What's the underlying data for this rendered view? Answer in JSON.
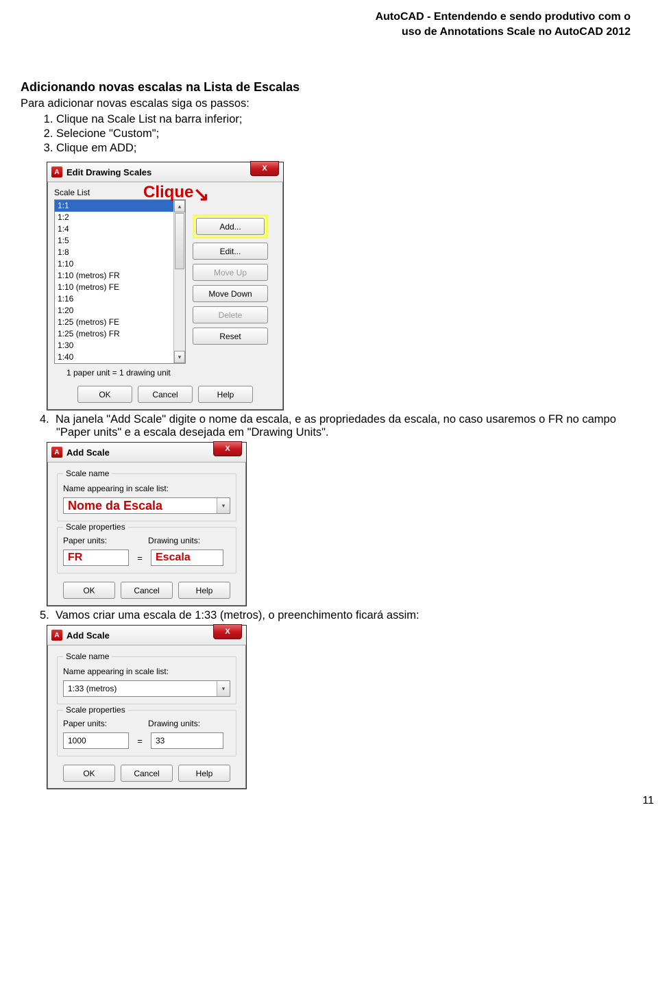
{
  "header": {
    "line1": "AutoCAD - Entendendo e sendo produtivo com o",
    "line2": "uso de Annotations Scale no AutoCAD 2012"
  },
  "section_title": "Adicionando novas escalas na Lista de Escalas",
  "intro": "Para adicionar novas escalas siga os passos:",
  "steps123": [
    "Clique na Scale List na barra inferior;",
    "Selecione \"Custom\";",
    "Clique em ADD;"
  ],
  "step4_num": "4.",
  "step4": "Na janela \"Add Scale\" digite o nome da escala, e as propriedades da escala, no caso usaremos o FR no campo \"Paper units\" e a escala desejada em \"Drawing Units\".",
  "step5_num": "5.",
  "step5": "Vamos criar uma escala de 1:33 (metros), o preenchimento ficará assim:",
  "page_number": "11",
  "editDialog": {
    "title": "Edit Drawing Scales",
    "close_x": "X",
    "scale_list_label": "Scale List",
    "clique_anno": "Clique",
    "items": [
      "1:1",
      "1:2",
      "1:4",
      "1:5",
      "1:8",
      "1:10",
      "1:10 (metros) FR",
      "1:10 (metros) FE",
      "1:16",
      "1:20",
      "1:25 (metros) FE",
      "1:25 (metros) FR",
      "1:30",
      "1:40"
    ],
    "buttons": {
      "add": "Add...",
      "edit": "Edit...",
      "moveup": "Move Up",
      "movedown": "Move Down",
      "delete": "Delete",
      "reset": "Reset"
    },
    "status": "1 paper unit = 1 drawing unit",
    "footer": {
      "ok": "OK",
      "cancel": "Cancel",
      "help": "Help"
    },
    "scroll_up": "▴",
    "scroll_down": "▾"
  },
  "addDialog1": {
    "title": "Add Scale",
    "close_x": "X",
    "scale_name_legend": "Scale name",
    "name_label": "Name appearing in scale list:",
    "name_value": "Nome da Escala",
    "props_legend": "Scale properties",
    "paper_label": "Paper units:",
    "drawing_label": "Drawing units:",
    "paper_value": "FR",
    "eq": "=",
    "drawing_value": "Escala",
    "combo_drop": "▾",
    "footer": {
      "ok": "OK",
      "cancel": "Cancel",
      "help": "Help"
    }
  },
  "addDialog2": {
    "title": "Add Scale",
    "close_x": "X",
    "scale_name_legend": "Scale name",
    "name_label": "Name appearing in scale list:",
    "name_value": "1:33 (metros)",
    "props_legend": "Scale properties",
    "paper_label": "Paper units:",
    "drawing_label": "Drawing units:",
    "paper_value": "1000",
    "eq": "=",
    "drawing_value": "33",
    "combo_drop": "▾",
    "footer": {
      "ok": "OK",
      "cancel": "Cancel",
      "help": "Help"
    }
  }
}
